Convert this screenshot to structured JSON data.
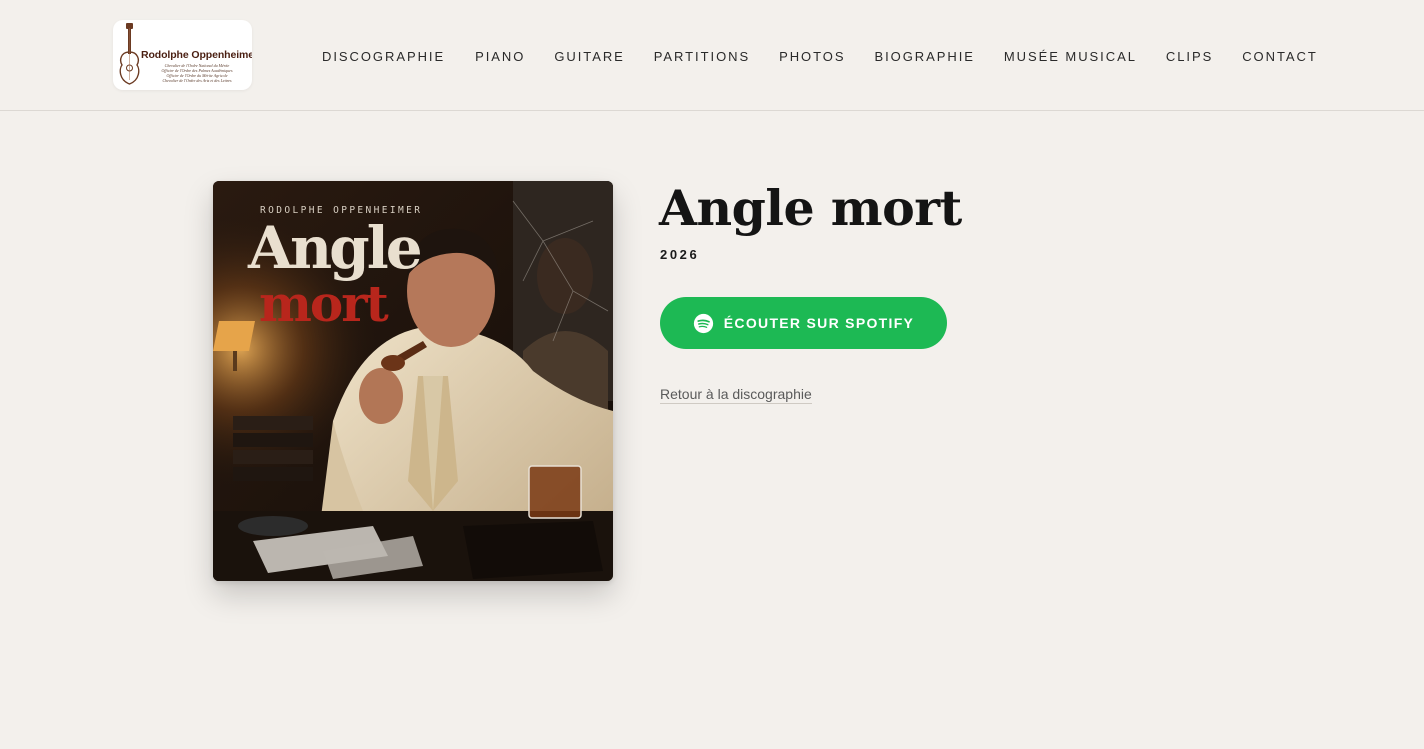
{
  "header": {
    "logo": {
      "name": "Rodolphe Oppenheimer",
      "lines": [
        "Chevalier de l'Ordre National du Mérite",
        "Officier de l'Ordre des Palmes Académiques",
        "Officier de l'Ordre du Mérite Agricole",
        "Chevalier de l'Ordre des Arts et des Lettres"
      ]
    },
    "nav": [
      {
        "label": "DISCOGRAPHIE"
      },
      {
        "label": "PIANO"
      },
      {
        "label": "GUITARE"
      },
      {
        "label": "PARTITIONS"
      },
      {
        "label": "PHOTOS"
      },
      {
        "label": "BIOGRAPHIE"
      },
      {
        "label": "MUSÉE MUSICAL"
      },
      {
        "label": "CLIPS"
      },
      {
        "label": "CONTACT"
      }
    ]
  },
  "album": {
    "cover": {
      "artist": "RODOLPHE OPPENHEIMER",
      "title_line1": "Angle",
      "title_line2": "mort"
    },
    "title": "Angle mort",
    "year": "2026",
    "spotify_label": "ÉCOUTER SUR SPOTIFY",
    "back_label": "Retour à la discographie"
  },
  "colors": {
    "background": "#f3f0ec",
    "spotify_green": "#1db954",
    "title": "#141414",
    "cover_red": "#b8261c"
  },
  "icons": {
    "spotify": "spotify-icon",
    "logo_guitar": "guitar-icon"
  }
}
